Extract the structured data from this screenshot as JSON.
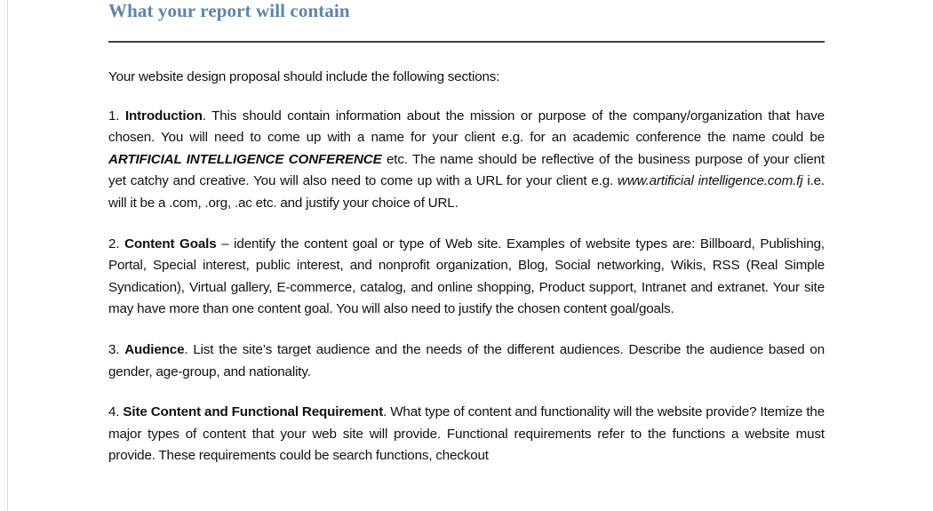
{
  "document": {
    "heading": "What your report will contain",
    "accent_color": "#5b85ad",
    "rule_color": "#404040",
    "text_color": "#111111",
    "background_color": "#ffffff"
  },
  "paragraphs": {
    "intro": "Your website design proposal should include the following sections:",
    "item1": {
      "number": "1.",
      "title": "Introduction",
      "text_a": ". This should contain information about the mission or purpose of the company/organization that have chosen. You will need to come up with a name for your client e.g. for an academic conference the name could be ",
      "emphasis_a": "ARTIFICIAL INTELLIGENCE CONFERENCE",
      "text_b": " etc. The name should be reflective of the business purpose of your client yet catchy and creative. You will also need to come up with a URL for your client e.g. ",
      "emphasis_b": "www.artificial intelligence.com.fj",
      "text_c": " i.e. will it be a .com, .org, .ac etc. and justify your choice of URL."
    },
    "item2": {
      "number": "2.",
      "title": "Content Goals",
      "text_a": " – identify the content goal or type of Web site. Examples of website types are: Billboard, Publishing, Portal, Special interest, public interest, and nonprofit organization, Blog, Social networking, Wikis, RSS (Real Simple Syndication), Virtual gallery, E-commerce, catalog, and online shopping, Product support, Intranet and extranet. Your site may have more than one content goal. You will also need to justify the chosen content goal/goals."
    },
    "item3": {
      "number": "3.",
      "title": "Audience",
      "text_a": ". List the site’s target audience and the needs of the different audiences. Describe the audience based on gender, age-group, and nationality."
    },
    "item4": {
      "number": "4.",
      "title": "Site Content and Functional Requirement",
      "text_a": ". What type of content and functionality will the website provide? Itemize the major types of content that your web site will provide. Functional requirements refer to the functions a website must provide. These requirements could be search functions, checkout"
    }
  }
}
